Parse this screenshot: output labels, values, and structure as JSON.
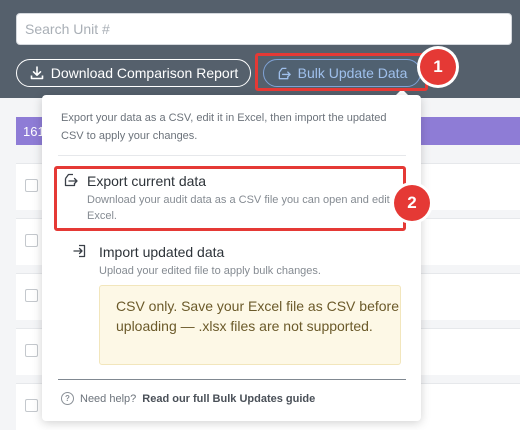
{
  "search": {
    "placeholder": "Search Unit #"
  },
  "toolbar": {
    "download_label": "Download Comparison Report",
    "download_icon": "download-icon",
    "bulk_label": "Bulk Update Data",
    "bulk_icon": "export-icon"
  },
  "annotations": {
    "badge_1": "1",
    "badge_2": "2",
    "highlight_color": "#e53935"
  },
  "list": {
    "count_text": "161"
  },
  "popup": {
    "intro": "Export your data as a CSV, edit it in Excel, then import the updated CSV to apply your changes.",
    "export": {
      "title": "Export current data",
      "description": "Download your audit data as a CSV file you can open and edit in Excel.",
      "icon": "export-icon"
    },
    "import": {
      "title": "Import updated data",
      "description": "Upload your edited file to apply bulk changes.",
      "icon": "import-icon",
      "note": "CSV only. Save your Excel file as CSV before uploading — .xlsx files are not supported."
    },
    "help": {
      "prefix": "Need help?",
      "link": "Read our full Bulk Updates guide",
      "icon": "question-icon"
    }
  },
  "colors": {
    "header_bg": "#55606c",
    "accent_purple": "#8e7cd6",
    "bulk_button_text": "#9fc0ec",
    "note_bg": "#fdf8e6"
  }
}
